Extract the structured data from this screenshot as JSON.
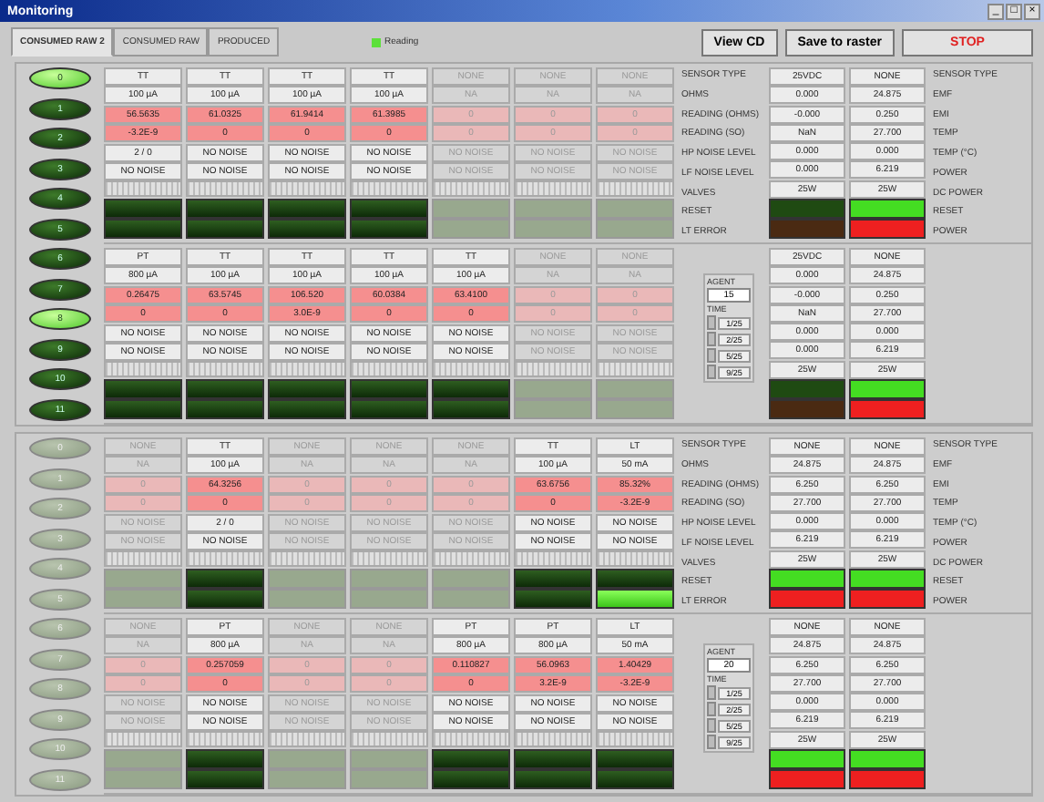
{
  "window": {
    "title": "Monitoring",
    "controls": [
      "_",
      "□",
      "×"
    ]
  },
  "tabs": [
    {
      "label": "CONSUMED RAW 2",
      "selected": true
    },
    {
      "label": "CONSUMED RAW",
      "selected": false
    },
    {
      "label": "PRODUCED",
      "selected": false
    }
  ],
  "reading_indicator": {
    "label": "Reading",
    "on": true
  },
  "buttons": [
    {
      "label": "View CD",
      "kind": "normal"
    },
    {
      "label": "Save to raster",
      "kind": "normal"
    },
    {
      "label": "STOP",
      "kind": "stop"
    }
  ],
  "panels": [
    {
      "enabled": true,
      "channels": [
        {
          "label": "0",
          "on": true
        },
        {
          "label": "1",
          "on": false
        },
        {
          "label": "2",
          "on": false
        },
        {
          "label": "3",
          "on": false
        },
        {
          "label": "4",
          "on": false
        },
        {
          "label": "5",
          "on": false
        },
        {
          "label": "6",
          "on": false
        },
        {
          "label": "7",
          "on": false
        },
        {
          "label": "8",
          "on": true
        },
        {
          "label": "9",
          "on": false
        },
        {
          "label": "10",
          "on": false
        },
        {
          "label": "11",
          "on": false
        }
      ],
      "groups": [
        {
          "columns": [
            {
              "active": true,
              "cells": [
                "TT",
                "100 µA",
                "56.5635",
                "-3.2E-9",
                "2 / 0",
                "NO NOISE"
              ],
              "reset_on": false,
              "error_on": false
            },
            {
              "active": true,
              "cells": [
                "TT",
                "100 µA",
                "61.0325",
                "0",
                "NO NOISE",
                "NO NOISE"
              ],
              "reset_on": false,
              "error_on": false
            },
            {
              "active": true,
              "cells": [
                "TT",
                "100 µA",
                "61.9414",
                "0",
                "NO NOISE",
                "NO NOISE"
              ],
              "reset_on": false,
              "error_on": false
            },
            {
              "active": true,
              "cells": [
                "TT",
                "100 µA",
                "61.3985",
                "0",
                "NO NOISE",
                "NO NOISE"
              ],
              "reset_on": false,
              "error_on": false
            },
            {
              "active": false,
              "cells": [
                "NONE",
                "NA",
                "0",
                "0",
                "NO NOISE",
                "NO NOISE"
              ],
              "reset_on": false,
              "error_on": false
            },
            {
              "active": false,
              "cells": [
                "NONE",
                "NA",
                "0",
                "0",
                "NO NOISE",
                "NO NOISE"
              ],
              "reset_on": false,
              "error_on": false
            },
            {
              "active": false,
              "cells": [
                "NONE",
                "NA",
                "0",
                "0",
                "NO NOISE",
                "NO NOISE"
              ],
              "reset_on": false,
              "error_on": false
            }
          ],
          "left_labels": [
            "SENSOR TYPE",
            "OHMS",
            "READING (OHMS)",
            "READING (SO)",
            "HP NOISE LEVEL",
            "LF NOISE LEVEL",
            "VALVES",
            "RESET",
            "LT ERROR"
          ],
          "outputs": [
            {
              "cells": [
                "25VDC",
                "0.000",
                "-0.000",
                "NaN",
                "0.000",
                "0.000",
                "25W"
              ],
              "leds": [
                {
                  "color": "#1f4a12"
                },
                {
                  "color": "#4a2a12"
                }
              ]
            },
            {
              "cells": [
                "NONE",
                "24.875",
                "0.250",
                "27.700",
                "0.000",
                "6.219",
                "25W"
              ],
              "leds": [
                {
                  "color": "#44dd22"
                },
                {
                  "color": "#ee2020"
                }
              ]
            }
          ],
          "right_labels": [
            "SENSOR TYPE",
            "EMF",
            "EMI",
            "TEMP",
            "TEMP (°C)",
            "POWER",
            "DC POWER",
            "RESET",
            "POWER"
          ]
        },
        {
          "columns": [
            {
              "active": true,
              "cells": [
                "PT",
                "800 µA",
                "0.26475",
                "0",
                "NO NOISE",
                "NO NOISE"
              ],
              "reset_on": false,
              "error_on": false
            },
            {
              "active": true,
              "cells": [
                "TT",
                "100 µA",
                "63.5745",
                "0",
                "NO NOISE",
                "NO NOISE"
              ],
              "reset_on": false,
              "error_on": false
            },
            {
              "active": true,
              "cells": [
                "TT",
                "100 µA",
                "106.520",
                "3.0E-9",
                "NO NOISE",
                "NO NOISE"
              ],
              "reset_on": false,
              "error_on": false
            },
            {
              "active": true,
              "cells": [
                "TT",
                "100 µA",
                "60.0384",
                "0",
                "NO NOISE",
                "NO NOISE"
              ],
              "reset_on": false,
              "error_on": false
            },
            {
              "active": true,
              "cells": [
                "TT",
                "100 µA",
                "63.4100",
                "0",
                "NO NOISE",
                "NO NOISE"
              ],
              "reset_on": false,
              "error_on": false
            },
            {
              "active": false,
              "cells": [
                "NONE",
                "NA",
                "0",
                "0",
                "NO NOISE",
                "NO NOISE"
              ],
              "reset_on": false,
              "error_on": false
            },
            {
              "active": false,
              "cells": [
                "NONE",
                "NA",
                "0",
                "0",
                "NO NOISE",
                "NO NOISE"
              ],
              "reset_on": false,
              "error_on": false
            }
          ],
          "agent": {
            "label": "AGENT",
            "value": "15",
            "time_label": "TIME",
            "options": [
              {
                "label": "1/25",
                "checked": false
              },
              {
                "label": "2/25",
                "checked": false
              },
              {
                "label": "5/25",
                "checked": false
              },
              {
                "label": "9/25",
                "checked": false
              }
            ]
          },
          "outputs": [
            {
              "cells": [
                "25VDC",
                "0.000",
                "-0.000",
                "NaN",
                "0.000",
                "0.000",
                "25W"
              ],
              "leds": [
                {
                  "color": "#1f4a12"
                },
                {
                  "color": "#4a2a12"
                }
              ]
            },
            {
              "cells": [
                "NONE",
                "24.875",
                "0.250",
                "27.700",
                "0.000",
                "6.219",
                "25W"
              ],
              "leds": [
                {
                  "color": "#44dd22"
                },
                {
                  "color": "#ee2020"
                }
              ]
            }
          ]
        }
      ]
    },
    {
      "enabled": false,
      "channels": [
        {
          "label": "0",
          "on": false
        },
        {
          "label": "1",
          "on": false
        },
        {
          "label": "2",
          "on": false
        },
        {
          "label": "3",
          "on": false
        },
        {
          "label": "4",
          "on": false
        },
        {
          "label": "5",
          "on": false
        },
        {
          "label": "6",
          "on": false
        },
        {
          "label": "7",
          "on": false
        },
        {
          "label": "8",
          "on": false
        },
        {
          "label": "9",
          "on": false
        },
        {
          "label": "10",
          "on": false
        },
        {
          "label": "11",
          "on": false
        }
      ],
      "groups": [
        {
          "columns": [
            {
              "active": false,
              "cells": [
                "NONE",
                "NA",
                "0",
                "0",
                "NO NOISE",
                "NO NOISE"
              ],
              "reset_on": false,
              "error_on": false
            },
            {
              "active": true,
              "cells": [
                "TT",
                "100 µA",
                "64.3256",
                "0",
                "2 / 0",
                "NO NOISE"
              ],
              "reset_on": false,
              "error_on": false
            },
            {
              "active": false,
              "cells": [
                "NONE",
                "NA",
                "0",
                "0",
                "NO NOISE",
                "NO NOISE"
              ],
              "reset_on": false,
              "error_on": false
            },
            {
              "active": false,
              "cells": [
                "NONE",
                "NA",
                "0",
                "0",
                "NO NOISE",
                "NO NOISE"
              ],
              "reset_on": false,
              "error_on": false
            },
            {
              "active": false,
              "cells": [
                "NONE",
                "NA",
                "0",
                "0",
                "NO NOISE",
                "NO NOISE"
              ],
              "reset_on": false,
              "error_on": false
            },
            {
              "active": true,
              "cells": [
                "TT",
                "100 µA",
                "63.6756",
                "0",
                "NO NOISE",
                "NO NOISE"
              ],
              "reset_on": false,
              "error_on": false
            },
            {
              "active": true,
              "cells": [
                "LT",
                "50 mA",
                "85.32%",
                "-3.2E-9",
                "NO NOISE",
                "NO NOISE"
              ],
              "reset_on": false,
              "error_on": true
            }
          ],
          "left_labels": [
            "SENSOR TYPE",
            "OHMS",
            "READING (OHMS)",
            "READING (SO)",
            "HP NOISE LEVEL",
            "LF NOISE LEVEL",
            "VALVES",
            "RESET",
            "LT ERROR"
          ],
          "outputs": [
            {
              "cells": [
                "NONE",
                "24.875",
                "6.250",
                "27.700",
                "0.000",
                "6.219",
                "25W"
              ],
              "leds": [
                {
                  "color": "#44dd22"
                },
                {
                  "color": "#ee2020"
                }
              ]
            },
            {
              "cells": [
                "NONE",
                "24.875",
                "6.250",
                "27.700",
                "0.000",
                "6.219",
                "25W"
              ],
              "leds": [
                {
                  "color": "#44dd22"
                },
                {
                  "color": "#ee2020"
                }
              ]
            }
          ],
          "right_labels": [
            "SENSOR TYPE",
            "EMF",
            "EMI",
            "TEMP",
            "TEMP (°C)",
            "POWER",
            "DC POWER",
            "RESET",
            "POWER"
          ]
        },
        {
          "columns": [
            {
              "active": false,
              "cells": [
                "NONE",
                "NA",
                "0",
                "0",
                "NO NOISE",
                "NO NOISE"
              ],
              "reset_on": false,
              "error_on": false
            },
            {
              "active": true,
              "cells": [
                "PT",
                "800 µA",
                "0.257059",
                "0",
                "NO NOISE",
                "NO NOISE"
              ],
              "reset_on": false,
              "error_on": false
            },
            {
              "active": false,
              "cells": [
                "NONE",
                "NA",
                "0",
                "0",
                "NO NOISE",
                "NO NOISE"
              ],
              "reset_on": false,
              "error_on": false
            },
            {
              "active": false,
              "cells": [
                "NONE",
                "NA",
                "0",
                "0",
                "NO NOISE",
                "NO NOISE"
              ],
              "reset_on": false,
              "error_on": false
            },
            {
              "active": true,
              "cells": [
                "PT",
                "800 µA",
                "0.110827",
                "0",
                "NO NOISE",
                "NO NOISE"
              ],
              "reset_on": false,
              "error_on": false
            },
            {
              "active": true,
              "cells": [
                "PT",
                "800 µA",
                "56.0963",
                "3.2E-9",
                "NO NOISE",
                "NO NOISE"
              ],
              "reset_on": false,
              "error_on": false
            },
            {
              "active": true,
              "cells": [
                "LT",
                "50 mA",
                "1.40429",
                "-3.2E-9",
                "NO NOISE",
                "NO NOISE"
              ],
              "reset_on": false,
              "error_on": false
            }
          ],
          "agent": {
            "label": "AGENT",
            "value": "20",
            "time_label": "TIME",
            "options": [
              {
                "label": "1/25",
                "checked": false
              },
              {
                "label": "2/25",
                "checked": false
              },
              {
                "label": "5/25",
                "checked": false
              },
              {
                "label": "9/25",
                "checked": false
              }
            ]
          },
          "outputs": [
            {
              "cells": [
                "NONE",
                "24.875",
                "6.250",
                "27.700",
                "0.000",
                "6.219",
                "25W"
              ],
              "leds": [
                {
                  "color": "#44dd22"
                },
                {
                  "color": "#ee2020"
                }
              ]
            },
            {
              "cells": [
                "NONE",
                "24.875",
                "6.250",
                "27.700",
                "0.000",
                "6.219",
                "25W"
              ],
              "leds": [
                {
                  "color": "#44dd22"
                },
                {
                  "color": "#ee2020"
                }
              ]
            }
          ]
        }
      ]
    }
  ]
}
